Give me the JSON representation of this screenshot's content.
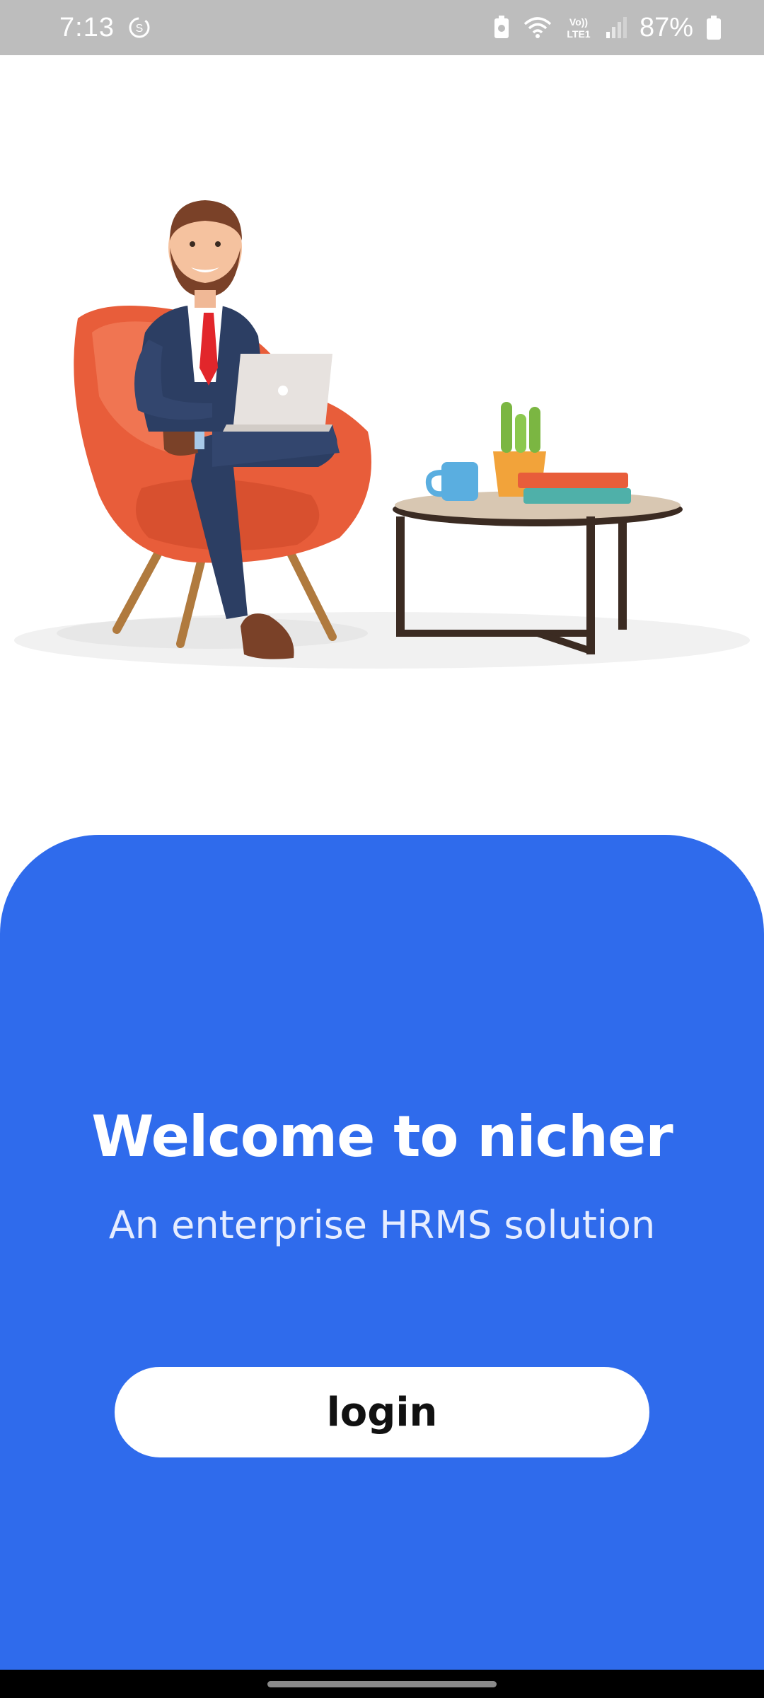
{
  "status_bar": {
    "time": "7:13",
    "battery_percent": "87%",
    "network_label": "Vo) LTE1",
    "icons": [
      "sync-icon",
      "battery-saver-icon",
      "wifi-icon",
      "volte-lte-icon",
      "signal-icon",
      "battery-icon"
    ]
  },
  "hero": {
    "illustration": "man-in-armchair-with-laptop-and-coffee-table"
  },
  "welcome": {
    "title": "Welcome to nicher",
    "subtitle": "An enterprise HRMS solution"
  },
  "actions": {
    "login_label": "login"
  },
  "colors": {
    "primary": "#2f6bec",
    "status_bar": "#bdbdbd",
    "button_bg": "#ffffff",
    "button_text": "#111111"
  }
}
